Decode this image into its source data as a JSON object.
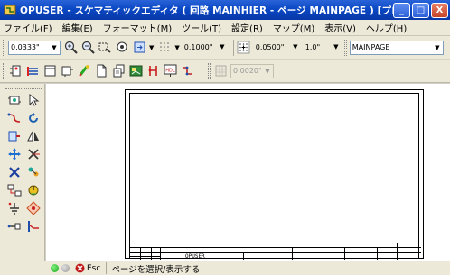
{
  "window": {
    "title": "OPUSER - スケマティックエディタ ( 回路 MAINHIER - ページ MAINPAGE ) [プロジェク...",
    "minimize_label": "_",
    "maximize_label": "□",
    "close_label": "X"
  },
  "menu": {
    "items": [
      "ファイル(F)",
      "編集(E)",
      "フォーマット(M)",
      "ツール(T)",
      "設定(R)",
      "マップ(M)",
      "表示(V)",
      "ヘルプ(H)"
    ]
  },
  "toolbar1": {
    "grid_size": "0.0333\"",
    "line_width": "0.1000\"",
    "snap_size": "0.0500\"",
    "angle": "1.0\"",
    "page_select": "MAINPAGE"
  },
  "toolbar2": {
    "disabled_value": "0.0020\""
  },
  "canvas": {
    "title_block_text": "OPUSER"
  },
  "status": {
    "esc_label": "Esc",
    "message": "ページを選択/表示する"
  },
  "colors": {
    "titlebar": "#0a48c4",
    "chrome": "#ece9d8",
    "status_green": "#1aa81a",
    "status_grey": "#9a9a9a",
    "esc_icon": "#c01818"
  }
}
